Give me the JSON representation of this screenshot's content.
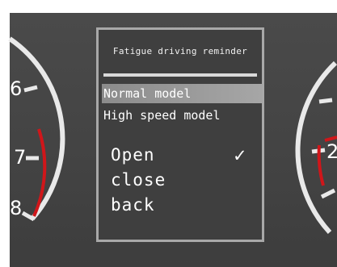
{
  "caption": "",
  "gauges": {
    "left_ticks": [
      "6",
      "7",
      "8"
    ],
    "right_ticks": [
      "2"
    ]
  },
  "menu": {
    "title": "Fatigue driving reminder",
    "modes": [
      {
        "label": "Normal model",
        "selected": true
      },
      {
        "label": "High speed model",
        "selected": false
      }
    ],
    "options": [
      {
        "label": "Open",
        "checked": true
      },
      {
        "label": "close",
        "checked": false
      },
      {
        "label": "back",
        "checked": false
      }
    ],
    "check_icon": "check-mark-icon"
  },
  "colors": {
    "background": "#444444",
    "frame": "#a8a8a8",
    "highlight": "#9a9a9a",
    "redline": "#d0161a",
    "caption_text": "#1a6fc4"
  }
}
